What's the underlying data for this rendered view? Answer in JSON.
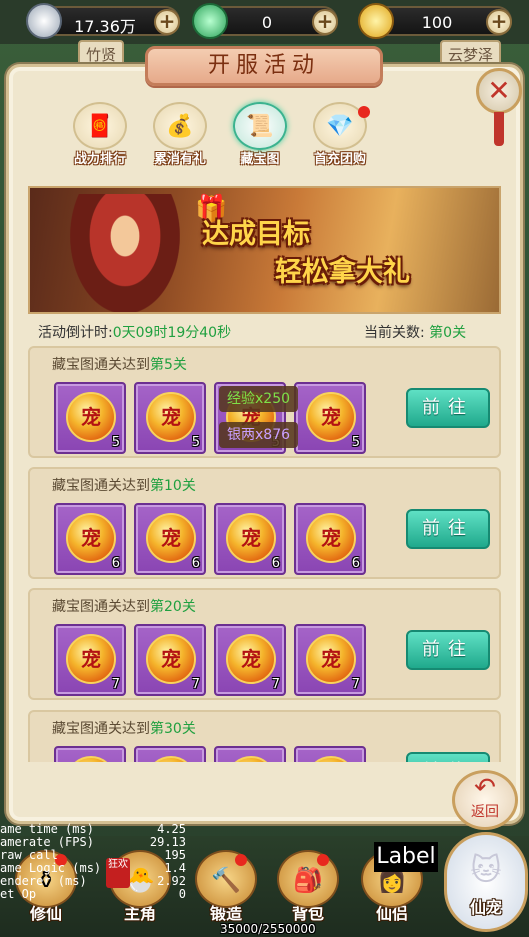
{
  "currency": [
    {
      "icon": "silver-ingot-icon",
      "value": "17.36万"
    },
    {
      "icon": "jade-icon",
      "value": "0"
    },
    {
      "icon": "gold-ingot-icon",
      "value": "100"
    }
  ],
  "background_tabs": [
    "竹贤",
    "云梦泽"
  ],
  "panel": {
    "title": "开服活动",
    "close_icon": "✕"
  },
  "tabs": [
    {
      "label": "战力排行",
      "glyph": "🧧",
      "active": false,
      "dot": false
    },
    {
      "label": "累消有礼",
      "glyph": "💰",
      "active": false,
      "dot": false
    },
    {
      "label": "藏宝图",
      "glyph": "📜",
      "active": true,
      "dot": false
    },
    {
      "label": "首充团购",
      "glyph": "💎",
      "active": false,
      "dot": true
    }
  ],
  "banner": {
    "line1": "达成目标",
    "line2": "轻松拿大礼"
  },
  "countdown": {
    "label": "活动倒计时:",
    "value": "0天09时19分40秒"
  },
  "stage": {
    "label": "当前关数:",
    "value": "第0关"
  },
  "tasks": [
    {
      "prefix": "藏宝图通关达到",
      "level": "第5关",
      "rewards": [
        "5",
        "5",
        "5",
        "5"
      ],
      "go": "前往"
    },
    {
      "prefix": "藏宝图通关达到",
      "level": "第10关",
      "rewards": [
        "6",
        "6",
        "6",
        "6"
      ],
      "go": "前往"
    },
    {
      "prefix": "藏宝图通关达到",
      "level": "第20关",
      "rewards": [
        "7",
        "7",
        "7",
        "7"
      ],
      "go": "前往"
    },
    {
      "prefix": "藏宝图通关达到",
      "level": "第30关",
      "rewards": [
        "",
        "",
        "",
        ""
      ],
      "go": "前往"
    }
  ],
  "reward_glyph": "宠",
  "tooltips": [
    {
      "text": "经验x250"
    },
    {
      "text": "银两x876"
    }
  ],
  "back": {
    "label": "返回"
  },
  "nav": [
    {
      "label": "修仙",
      "glyph": "⚱",
      "dot": true
    },
    {
      "label": "主角",
      "glyph": "🐣",
      "dot": false
    },
    {
      "label": "锻造",
      "glyph": "🔨",
      "dot": true
    },
    {
      "label": "背包",
      "glyph": "🎒",
      "dot": true
    },
    {
      "label": "仙侣",
      "glyph": "👩",
      "dot": false
    }
  ],
  "pet_nav": {
    "label": "仙宠",
    "glyph": "🐱"
  },
  "nav_badge": "狂欢",
  "label_box": "Label",
  "exp_text": "35000/2550000",
  "stats": [
    {
      "k": "ame time (ms)",
      "v": "4.25"
    },
    {
      "k": "amerate (FPS)",
      "v": "29.13"
    },
    {
      "k": "raw call",
      "v": "195"
    },
    {
      "k": "ame Logic (ms)",
      "v": "1.4"
    },
    {
      "k": "enderer (ms)",
      "v": "2.92"
    },
    {
      "k": "et Op",
      "v": "0"
    }
  ]
}
